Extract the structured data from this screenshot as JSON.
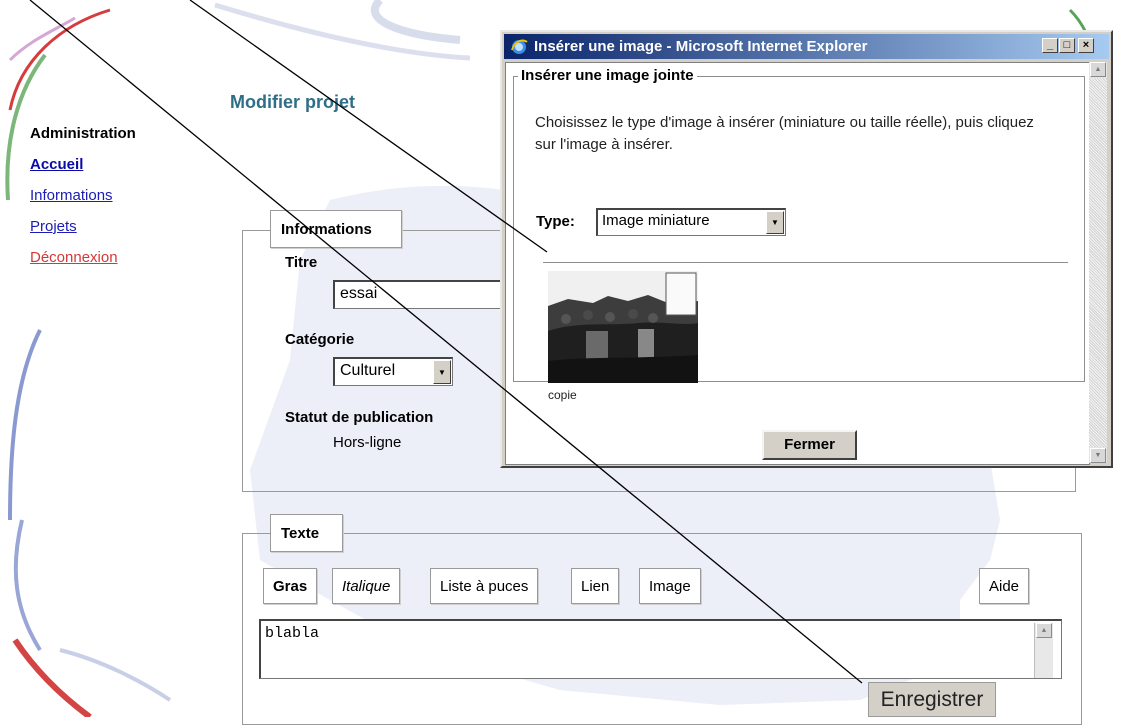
{
  "sidebar": {
    "heading": "Administration",
    "items": [
      {
        "label": "Accueil"
      },
      {
        "label": "Informations"
      },
      {
        "label": "Projets"
      },
      {
        "label": "Déconnexion"
      }
    ]
  },
  "page": {
    "title": "Modifier projet"
  },
  "info_section": {
    "legend": "Informations",
    "title_label": "Titre",
    "title_value": "essai",
    "category_label": "Catégorie",
    "category_value": "Culturel",
    "status_label": "Statut de publication",
    "status_value": "Hors-ligne"
  },
  "text_section": {
    "legend": "Texte",
    "toolbar": {
      "bold": "Gras",
      "italic": "Italique",
      "bullets": "Liste à puces",
      "link": "Lien",
      "image": "Image",
      "help": "Aide"
    },
    "editor_value": "blabla"
  },
  "save_button": "Enregistrer",
  "popup": {
    "window_title": "Insérer une image - Microsoft Internet Explorer",
    "window_buttons": {
      "minimize": "_",
      "maximize": "□",
      "close": "×"
    },
    "section_title": "Insérer une image jointe",
    "instructions": "Choisissez le type d'image à insérer (miniature ou taille réelle), puis cliquez sur l'image à insérer.",
    "type_label": "Type:",
    "type_value": "Image miniature",
    "thumbnail_caption": "copie",
    "close_button": "Fermer"
  },
  "colors": {
    "title_teal": "#2e6e86",
    "link_blue": "#1c1cb8",
    "logout_red": "#d43838",
    "ie_titlebar": "#0a246a"
  }
}
